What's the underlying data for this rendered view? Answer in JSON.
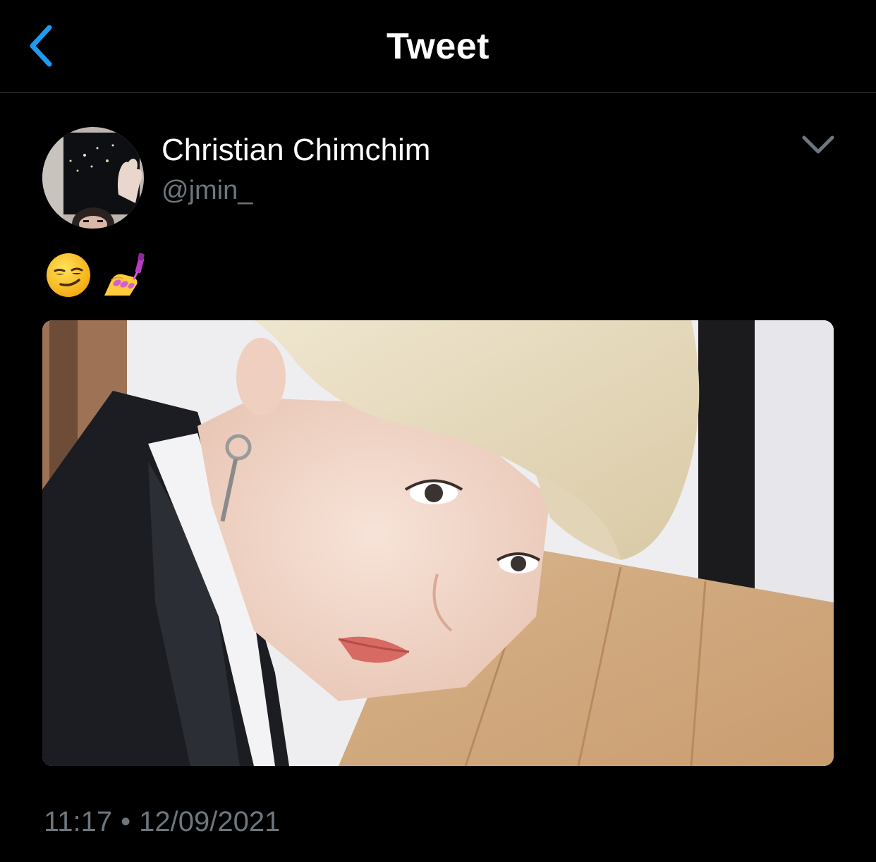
{
  "header": {
    "title": "Tweet",
    "back_icon": "chevron-left-icon"
  },
  "tweet": {
    "author": {
      "display_name": "Christian Chimchim",
      "handle": "@jmin_"
    },
    "more_icon": "chevron-down-icon",
    "text_emojis": [
      "smirking-face-emoji",
      "nail-polish-emoji"
    ],
    "time": "11:17",
    "separator": "•",
    "date": "12/09/2021"
  },
  "colors": {
    "background": "#000000",
    "accent": "#1d9bf0",
    "secondary_text": "#6e767d",
    "divider": "#2f3336"
  }
}
